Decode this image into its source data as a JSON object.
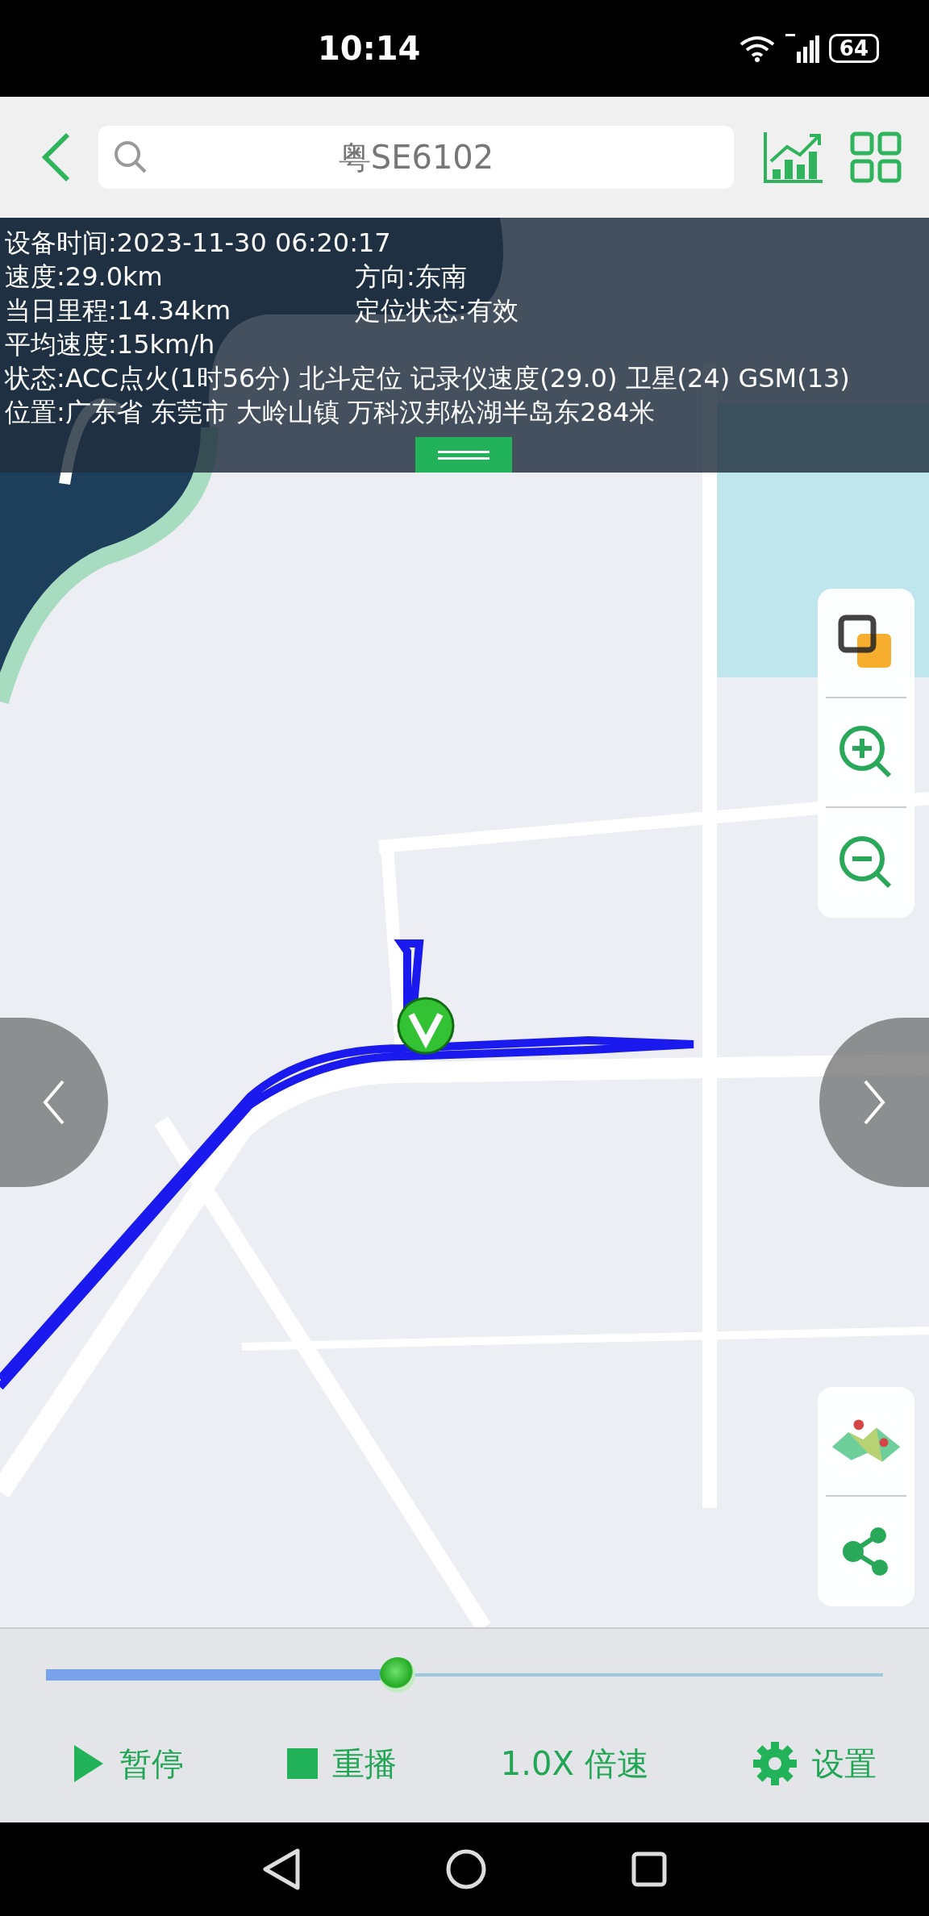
{
  "status_bar": {
    "time": "10:14",
    "battery": "64"
  },
  "header": {
    "search": {
      "value": "粤SE6102"
    }
  },
  "info_panel": {
    "rows": [
      [
        "设备时间:2023-11-30 06:20:17"
      ],
      [
        "速度:29.0km",
        "方向:东南"
      ],
      [
        "当日里程:14.34km",
        "定位状态:有效"
      ],
      [
        "平均速度:15km/h"
      ],
      [
        "状态:ACC点火(1时56分) 北斗定位 记录仪速度(29.0)  卫星(24) GSM(13)"
      ],
      [
        "位置:广东省 东莞市 大岭山镇 万科汉邦松湖半岛东284米"
      ]
    ]
  },
  "playback": {
    "level": 0.42,
    "controls": [
      {
        "kind": "play",
        "label": "暂停"
      },
      {
        "kind": "stop",
        "label": "重播"
      },
      {
        "kind": "speed",
        "label": "1.0X 倍速"
      },
      {
        "kind": "settings",
        "label": "设置"
      }
    ]
  }
}
